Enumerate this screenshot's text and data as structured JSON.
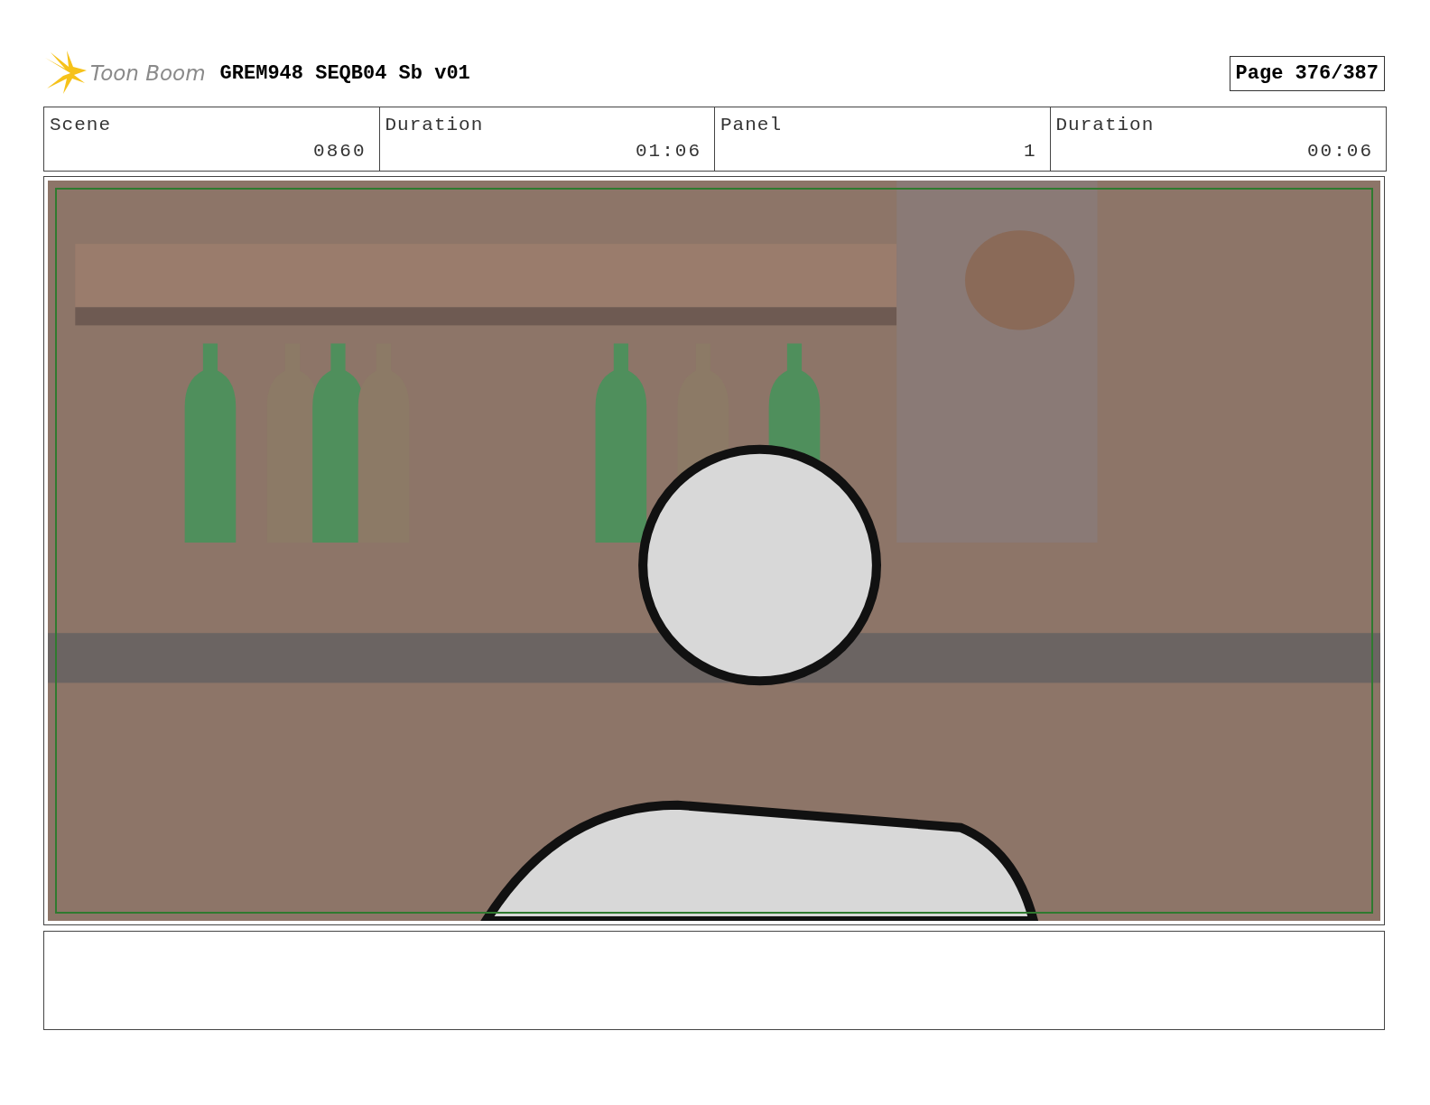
{
  "header": {
    "logo": "Toon Boom",
    "title": "GREM948 SEQB04 Sb v01",
    "page": "Page 376/387"
  },
  "fields": [
    {
      "label": "Scene",
      "value": "0860"
    },
    {
      "label": "Duration",
      "value": "01:06"
    },
    {
      "label": "Panel",
      "value": "1"
    },
    {
      "label": "Duration",
      "value": "00:06"
    }
  ]
}
